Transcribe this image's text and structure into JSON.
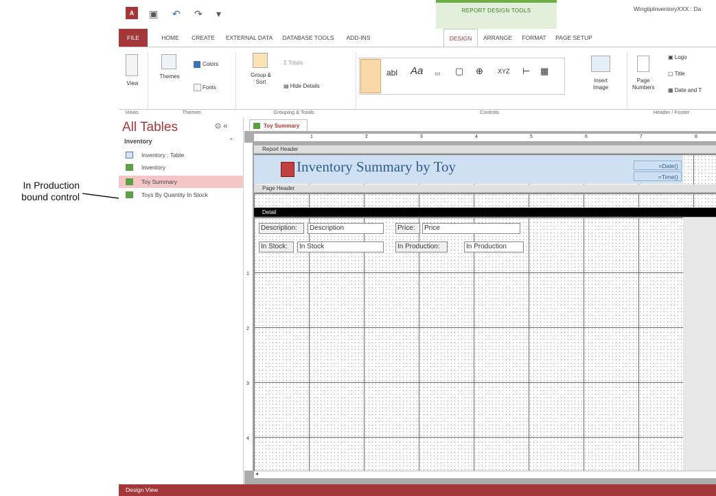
{
  "callout": {
    "line1": "In Production",
    "line2": "bound control"
  },
  "qat": {
    "app_logo": "A",
    "context_title": "REPORT DESIGN TOOLS",
    "window_title": "WingtipInventoryXXX : Da"
  },
  "tabs": [
    {
      "label": "FILE"
    },
    {
      "label": "HOME"
    },
    {
      "label": "CREATE"
    },
    {
      "label": "EXTERNAL DATA"
    },
    {
      "label": "DATABASE TOOLS"
    },
    {
      "label": "ADD-INS"
    },
    {
      "label": "DESIGN"
    },
    {
      "label": "ARRANGE"
    },
    {
      "label": "FORMAT"
    },
    {
      "label": "PAGE SETUP"
    }
  ],
  "ribbon": {
    "view": "View",
    "themes": "Themes",
    "colors": "Colors",
    "fonts": "Fonts",
    "group_sort": "Group & Sort",
    "totals": "Totals",
    "hide_details": "Hide Details",
    "insert_image": "Insert Image",
    "page_numbers": "Page Numbers",
    "logo": "Logo",
    "title": "Title",
    "date_time": "Date and T",
    "groups": {
      "views": "Views",
      "themes": "Themes",
      "grouping": "Grouping & Totals",
      "controls": "Controls",
      "header_footer": "Header / Footer"
    }
  },
  "nav": {
    "title": "All Tables",
    "group": "Inventory",
    "items": [
      {
        "label": "Inventory : Table"
      },
      {
        "label": "Inventory"
      },
      {
        "label": "Toy Summary"
      },
      {
        "label": "Toys By Quantity In Stock"
      }
    ]
  },
  "doc_tab": "Toy Summary",
  "sections": {
    "report_header": "Report Header",
    "page_header": "Page Header",
    "detail": "Detail"
  },
  "report": {
    "title": "Inventory Summary by Toy",
    "date": "=Date()",
    "time": "=Time()"
  },
  "fields": {
    "description_label": "Description:",
    "description_value": "Description",
    "price_label": "Price:",
    "price_value": "Price",
    "instock_label": "In Stock:",
    "instock_value": "In Stock",
    "inproduction_label": "In Production:",
    "inproduction_value": "In Production"
  },
  "ruler_marks": [
    "1",
    "2",
    "3",
    "4",
    "5",
    "6",
    "7",
    "8"
  ],
  "vruler_marks": [
    "1",
    "2",
    "3",
    "4"
  ],
  "status": "Design View",
  "colors": {
    "accent": "#a4373a",
    "context_green": "#70ad47",
    "title_blue": "#2e5c8a"
  }
}
